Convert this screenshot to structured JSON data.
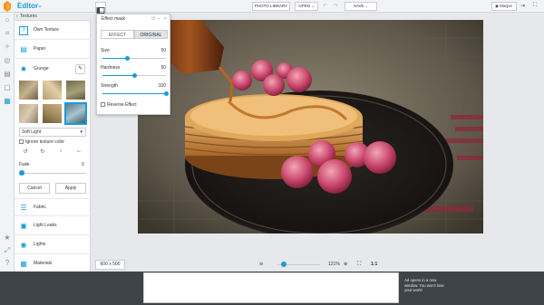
{
  "header": {
    "app_title": "Editor",
    "photo_library": "PHOTO LIBRARY",
    "open": "OPEN",
    "save": "SAVE",
    "user": "Marjon"
  },
  "panel": {
    "section": "Textures",
    "own_texture": "Own Texture",
    "paper": "Paper",
    "grunge": "Grunge",
    "blend_mode": "Soft Light",
    "ignore_color": "Ignore texture color",
    "fade_label": "Fade",
    "fade_value": "0",
    "fade_fraction": 0,
    "cancel": "Cancel",
    "apply": "Apply",
    "fabric": "Fabric",
    "light_leaks": "Light Leaks",
    "lights": "Lights",
    "materials": "Materials"
  },
  "mask": {
    "title": "Effect mask",
    "tab_effect": "EFFECT",
    "tab_original": "ORIGINAL",
    "size_label": "Size",
    "size_value": "50",
    "size_fraction": 0.38,
    "hardness_label": "Hardness",
    "hardness_value": "50",
    "hardness_fraction": 0.5,
    "strength_label": "Strength",
    "strength_value": "100",
    "strength_fraction": 1.0,
    "reverse_label": "Reverse Effect"
  },
  "canvas": {
    "dimensions": "600 x 500",
    "zoom": "121%",
    "zoom_fraction": 0.1,
    "one_to_one": "1:1"
  },
  "ad": {
    "text": "Ad opens in a new window. You won't lose your work!"
  },
  "colors": {
    "accent": "#1a9ad6",
    "rail_bg": "#f2f3f5",
    "footer_bg": "#3d4449"
  }
}
